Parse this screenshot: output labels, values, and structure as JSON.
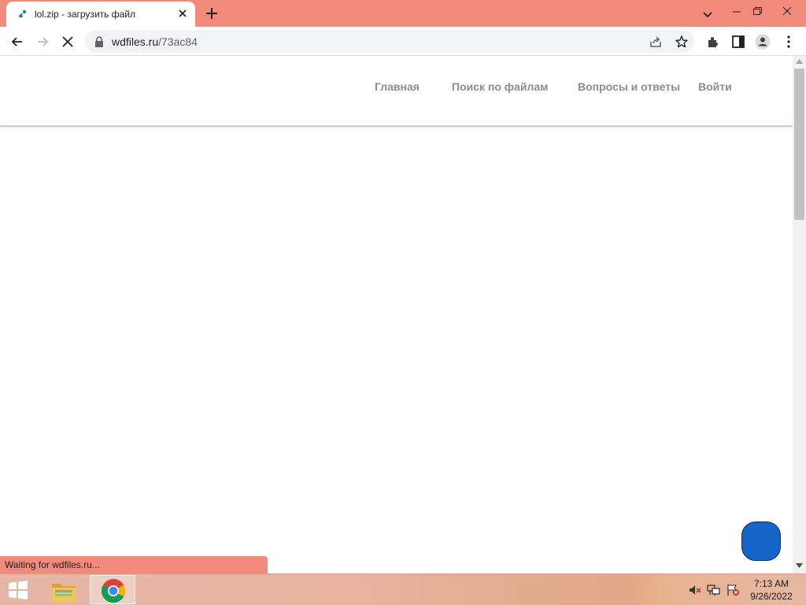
{
  "browser": {
    "tab": {
      "title": "lol.zip - загрузить файл"
    },
    "address_bar": {
      "domain": "wdfiles.ru",
      "path": "/73ac84"
    },
    "status_text": "Waiting for wdfiles.ru...",
    "icons": [
      "back-icon",
      "forward-icon",
      "stop-icon",
      "lock-icon",
      "share-icon",
      "star-icon",
      "extensions-icon",
      "side-panel-icon",
      "profile-icon",
      "menu-icon",
      "tab-search-icon",
      "new-tab-icon",
      "close-icon"
    ]
  },
  "site": {
    "nav": [
      {
        "label": "Главная",
        "icon": ""
      },
      {
        "label": "Поиск по файлам",
        "icon": ""
      },
      {
        "label": "Вопросы и ответы"
      },
      {
        "label": "Войти",
        "icon": ""
      }
    ]
  },
  "taskbar": {
    "time": "7:13 AM",
    "date": "9/26/2022",
    "tray_icons": [
      "volume-muted-icon",
      "network-icon",
      "action-center-flag-icon"
    ]
  },
  "colors": {
    "tab_strip": "#f28b7c",
    "status_bubble": "#f28b7c",
    "chat_button": "#1565c8",
    "nav_text": "#8c8c8c"
  }
}
